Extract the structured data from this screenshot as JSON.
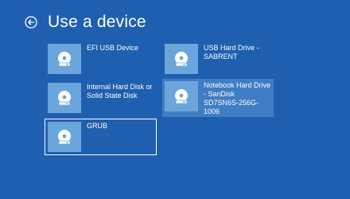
{
  "header": {
    "title": "Use a device",
    "back_icon": "back-arrow-circle-icon"
  },
  "devices": [
    {
      "label": "EFI USB Device",
      "icon": "disc-drive-icon",
      "state": "normal"
    },
    {
      "label": "USB Hard Drive -\nSABRENT",
      "icon": "disc-drive-icon",
      "state": "normal"
    },
    {
      "label": "Internal Hard Disk or\nSolid State Disk",
      "icon": "disc-drive-icon",
      "state": "normal"
    },
    {
      "label": "Notebook Hard Drive\n- SanDisk\nSD7SN6S-256G-1006",
      "icon": "disc-drive-icon",
      "state": "hovered"
    },
    {
      "label": "GRUB",
      "icon": "disc-drive-icon",
      "state": "selected"
    }
  ],
  "colors": {
    "background": "#1f5fb0",
    "tile_icon_bg": "#6aa6dc",
    "hover_bg": "#3f7dc4",
    "text": "#ffffff"
  }
}
